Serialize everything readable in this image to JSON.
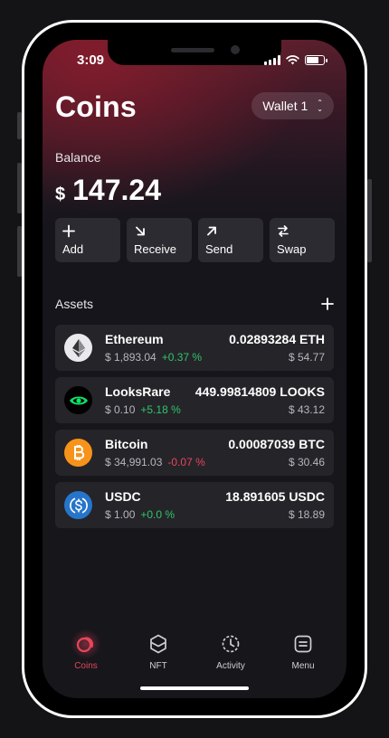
{
  "status": {
    "time": "3:09"
  },
  "header": {
    "title": "Coins",
    "wallet_label": "Wallet 1"
  },
  "balance": {
    "label": "Balance",
    "currency": "$",
    "amount": "147.24"
  },
  "actions": [
    {
      "label": "Add",
      "icon": "plus-icon"
    },
    {
      "label": "Receive",
      "icon": "arrow-down-right-icon"
    },
    {
      "label": "Send",
      "icon": "arrow-up-right-icon"
    },
    {
      "label": "Swap",
      "icon": "swap-icon"
    }
  ],
  "assets_section": {
    "title": "Assets"
  },
  "assets": [
    {
      "name": "Ethereum",
      "price": "$ 1,893.04",
      "change": "+0.37 %",
      "change_dir": "pos",
      "balance": "0.02893284 ETH",
      "value": "$ 54.77",
      "icon": "ethereum-icon"
    },
    {
      "name": "LooksRare",
      "price": "$ 0.10",
      "change": "+5.18 %",
      "change_dir": "pos",
      "balance": "449.99814809 LOOKS",
      "value": "$ 43.12",
      "icon": "looksrare-icon"
    },
    {
      "name": "Bitcoin",
      "price": "$ 34,991.03",
      "change": "-0.07 %",
      "change_dir": "neg",
      "balance": "0.00087039 BTC",
      "value": "$ 30.46",
      "icon": "bitcoin-icon"
    },
    {
      "name": "USDC",
      "price": "$ 1.00",
      "change": "+0.0 %",
      "change_dir": "pos",
      "balance": "18.891605 USDC",
      "value": "$ 18.89",
      "icon": "usdc-icon"
    }
  ],
  "tabs": [
    {
      "label": "Coins",
      "active": true,
      "icon": "coins-icon"
    },
    {
      "label": "NFT",
      "active": false,
      "icon": "nft-hexagon-icon"
    },
    {
      "label": "Activity",
      "active": false,
      "icon": "clock-icon"
    },
    {
      "label": "Menu",
      "active": false,
      "icon": "menu-icon"
    }
  ],
  "colors": {
    "accent": "#e8455a",
    "positive": "#2fc56a",
    "negative": "#e8455a",
    "card": "#252429"
  }
}
